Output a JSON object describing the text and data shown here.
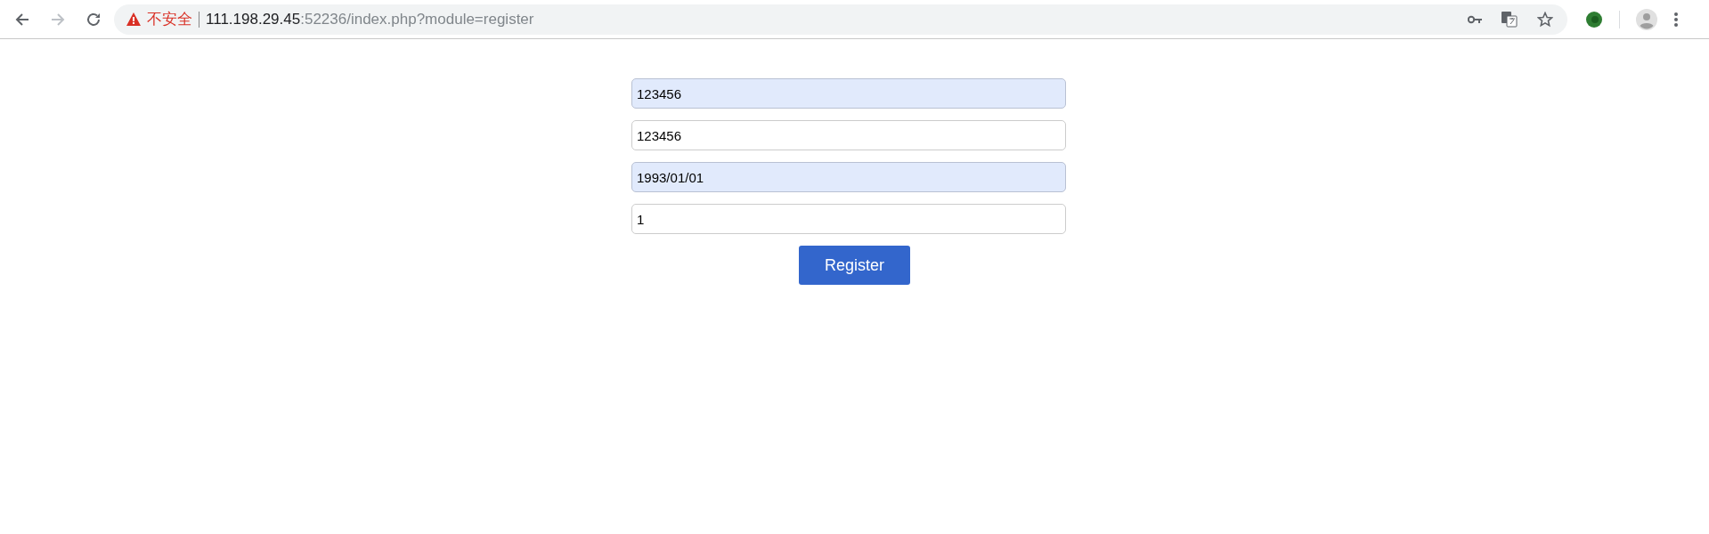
{
  "browser": {
    "security_label": "不安全",
    "url_host": "111.198.29.45",
    "url_rest": ":52236/index.php?module=register",
    "back_disabled": false,
    "forward_disabled": true
  },
  "form": {
    "fields": [
      {
        "value": "123456",
        "autofilled": true
      },
      {
        "value": "123456",
        "autofilled": false
      },
      {
        "value": "1993/01/01",
        "autofilled": true
      },
      {
        "value": "1",
        "autofilled": false
      }
    ],
    "submit": "Register"
  }
}
